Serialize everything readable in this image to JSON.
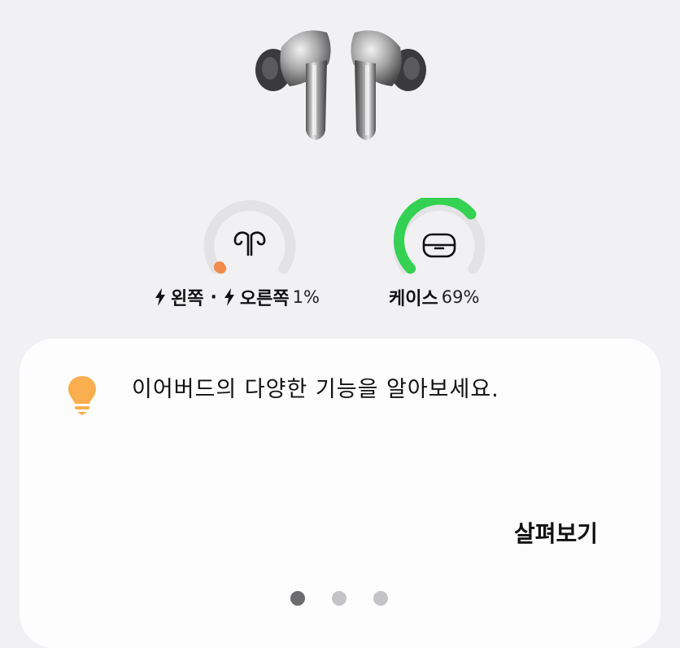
{
  "buds": {
    "left_label": "왼쪽",
    "separator": "·",
    "right_label": "오른쪽",
    "percent": "1%",
    "level": 0.01,
    "charging": true,
    "color": "#f28a4a"
  },
  "case": {
    "label": "케이스",
    "percent": "69%",
    "level": 0.69,
    "color": "#34d152"
  },
  "tip": {
    "text": "이어버드의 다양한 기능을 알아보세요.",
    "action_label": "살펴보기",
    "icon": "lightbulb-icon",
    "icon_color": "#fbae50"
  },
  "pagination": {
    "count": 3,
    "active_index": 0
  },
  "colors": {
    "track": "#e3e3e5",
    "background": "#f1f1f3",
    "card": "#fdfdfe"
  }
}
